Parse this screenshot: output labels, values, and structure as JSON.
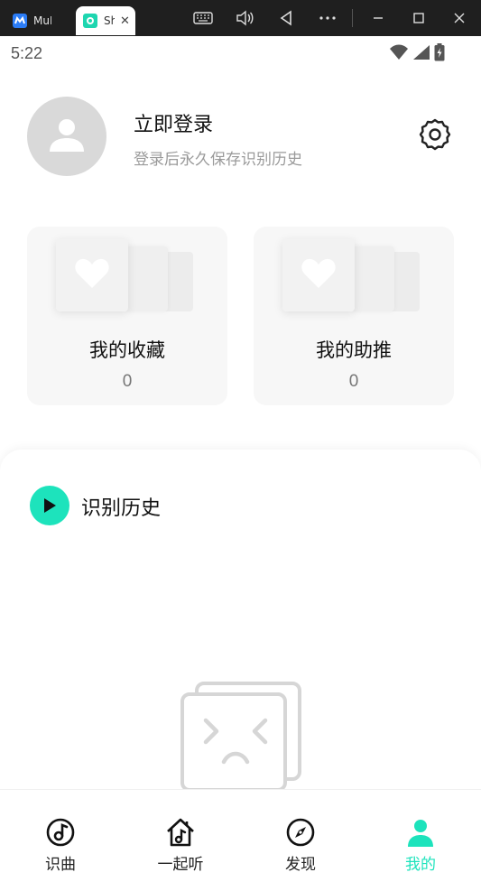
{
  "window": {
    "tabs": [
      {
        "label": "MuMu",
        "icon": "mumu-app-icon"
      },
      {
        "label": "Shazam",
        "icon": "shazam-app-icon",
        "active": true
      }
    ],
    "controls": [
      "keyboard-icon",
      "volume-icon",
      "back-icon",
      "more-icon",
      "minimize-icon",
      "maximize-icon",
      "close-icon"
    ]
  },
  "status_bar": {
    "time": "5:22",
    "icons": [
      "wifi-icon",
      "signal-icon",
      "battery-charging-icon"
    ]
  },
  "profile": {
    "login_title": "立即登录",
    "login_subtitle": "登录后永久保存识别历史"
  },
  "cards": [
    {
      "title": "我的收藏",
      "count": "0"
    },
    {
      "title": "我的助推",
      "count": "0"
    }
  ],
  "history": {
    "title": "识别历史"
  },
  "bottom_nav": {
    "items": [
      {
        "label": "识曲",
        "icon": "music-note-icon"
      },
      {
        "label": "一起听",
        "icon": "home-music-icon"
      },
      {
        "label": "发现",
        "icon": "compass-icon"
      },
      {
        "label": "我的",
        "icon": "person-icon",
        "active": true
      }
    ]
  },
  "colors": {
    "accent": "#1de3bc",
    "titlebar": "#1f1f1f",
    "card_bg": "#f7f7f7",
    "avatar_bg": "#d9d9d9"
  }
}
